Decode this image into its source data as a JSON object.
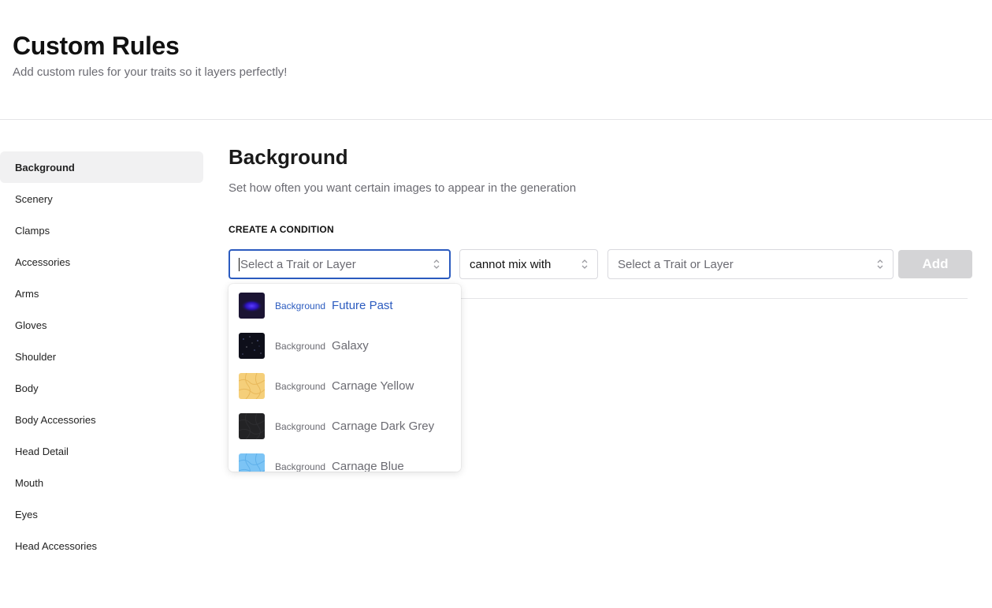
{
  "header": {
    "title": "Custom Rules",
    "subtitle": "Add custom rules for your traits so it layers perfectly!"
  },
  "sidebar": {
    "items": [
      {
        "label": "Background",
        "active": true
      },
      {
        "label": "Scenery"
      },
      {
        "label": "Clamps"
      },
      {
        "label": "Accessories"
      },
      {
        "label": "Arms"
      },
      {
        "label": "Gloves"
      },
      {
        "label": "Shoulder"
      },
      {
        "label": "Body"
      },
      {
        "label": "Body Accessories"
      },
      {
        "label": "Head Detail"
      },
      {
        "label": "Mouth"
      },
      {
        "label": "Eyes"
      },
      {
        "label": "Head Accessories"
      }
    ]
  },
  "main": {
    "title": "Background",
    "description": "Set how often you want certain images to appear in the generation",
    "condition_label": "CREATE A CONDITION",
    "first_select": {
      "placeholder": "Select a Trait or Layer"
    },
    "operator_select": {
      "value": "cannot mix with"
    },
    "second_select": {
      "placeholder": "Select a Trait or Layer"
    },
    "add_label": "Add"
  },
  "dropdown": {
    "options": [
      {
        "layer": "Background",
        "name": "Future Past",
        "thumb": "future-past",
        "highlighted": true
      },
      {
        "layer": "Background",
        "name": "Galaxy",
        "thumb": "galaxy"
      },
      {
        "layer": "Background",
        "name": "Carnage Yellow",
        "thumb": "carnage-yellow"
      },
      {
        "layer": "Background",
        "name": "Carnage Dark Grey",
        "thumb": "carnage-dark-grey"
      },
      {
        "layer": "Background",
        "name": "Carnage Blue",
        "thumb": "carnage-blue"
      }
    ]
  },
  "colors": {
    "accent": "#2b5bbf",
    "add_disabled": "#d4d4d6",
    "muted_text": "#6b6b72"
  }
}
